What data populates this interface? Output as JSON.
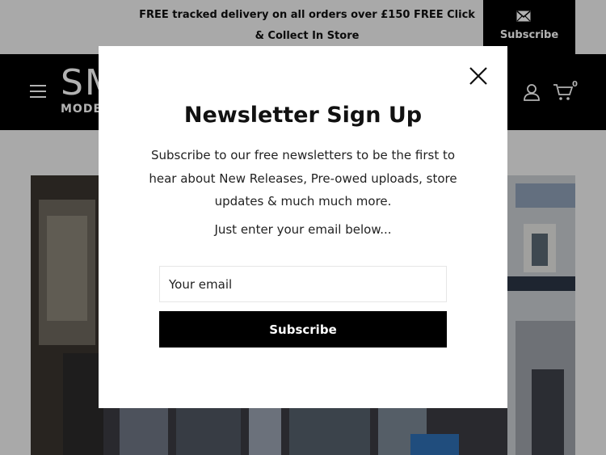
{
  "announcement": {
    "text": "FREE tracked delivery on all orders over £150    FREE Click & Collect In Store",
    "subscribe_label": "Subscribe",
    "subscribe_icon": "envelope-icon"
  },
  "header": {
    "logo_big": "SM",
    "logo_small": "MODEL",
    "cart_count": "0",
    "icons": [
      "hamburger-menu-icon",
      "account-icon",
      "cart-icon"
    ]
  },
  "modal": {
    "title": "Newsletter Sign Up",
    "description": "Subscribe to our free newsletters to be the first to hear about New Releases, Pre-owed uploads, store updates & much much more.",
    "subtext": "Just enter your email below...",
    "email_placeholder": "Your email",
    "button_label": "Subscribe"
  },
  "colors": {
    "header_bg": "#000000",
    "announcement_bg": "#f3f3f3",
    "button_bg": "#000000",
    "modal_bg": "#ffffff"
  }
}
